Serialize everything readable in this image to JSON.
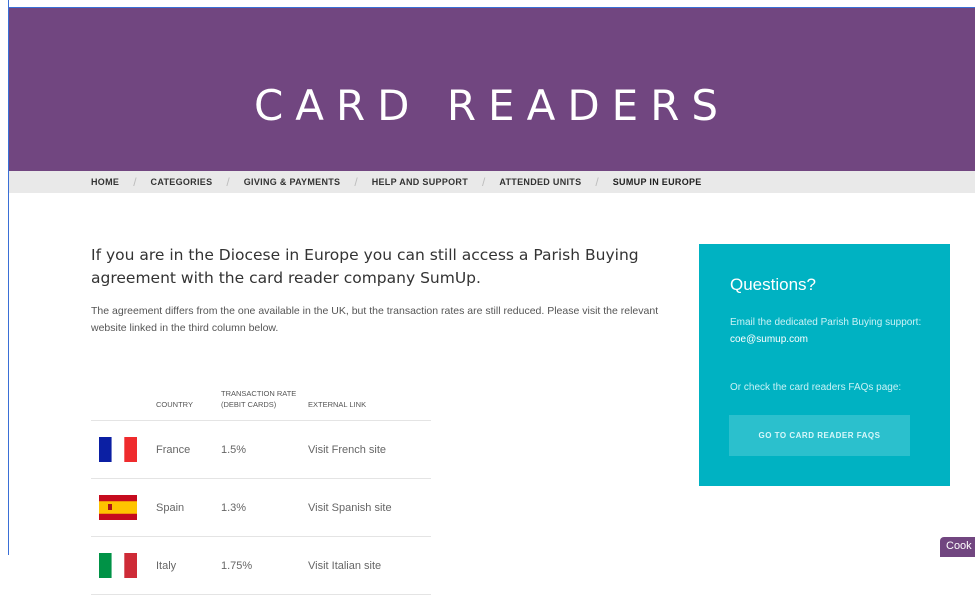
{
  "hero": {
    "title": "CARD READERS"
  },
  "breadcrumb": [
    {
      "label": "HOME"
    },
    {
      "label": "CATEGORIES"
    },
    {
      "label": "GIVING & PAYMENTS"
    },
    {
      "label": "HELP AND SUPPORT"
    },
    {
      "label": "ATTENDED UNITS"
    },
    {
      "label": "SUMUP IN EUROPE"
    }
  ],
  "main": {
    "intro": "If you are in the Diocese in Europe you can still access a Parish Buying agreement with the card reader company SumUp.",
    "description": "The agreement differs from the one available in the UK, but the transaction rates are still reduced. Please visit the relevant website linked in the third column below."
  },
  "table": {
    "headers": [
      "",
      "COUNTRY",
      "TRANSACTION RATE (DEBIT CARDS)",
      "EXTERNAL LINK"
    ],
    "rows": [
      {
        "country": "France",
        "rate": "1.5%",
        "link": "Visit French site",
        "flag": "france-flag"
      },
      {
        "country": "Spain",
        "rate": "1.3%",
        "link": "Visit Spanish site",
        "flag": "spain-flag"
      },
      {
        "country": "Italy",
        "rate": "1.75%",
        "link": "Visit Italian site",
        "flag": "italy-flag"
      }
    ]
  },
  "sidebar": {
    "title": "Questions?",
    "text": "Email the dedicated Parish Buying support:",
    "email": "coe@sumup.com",
    "text2": "Or check the card readers FAQs page:",
    "button": "GO TO CARD READER FAQS"
  },
  "cookie": {
    "label": "Cook"
  },
  "colors": {
    "hero": "#714680",
    "sidebar": "#00b2c2",
    "button": "#2bc0cd"
  }
}
